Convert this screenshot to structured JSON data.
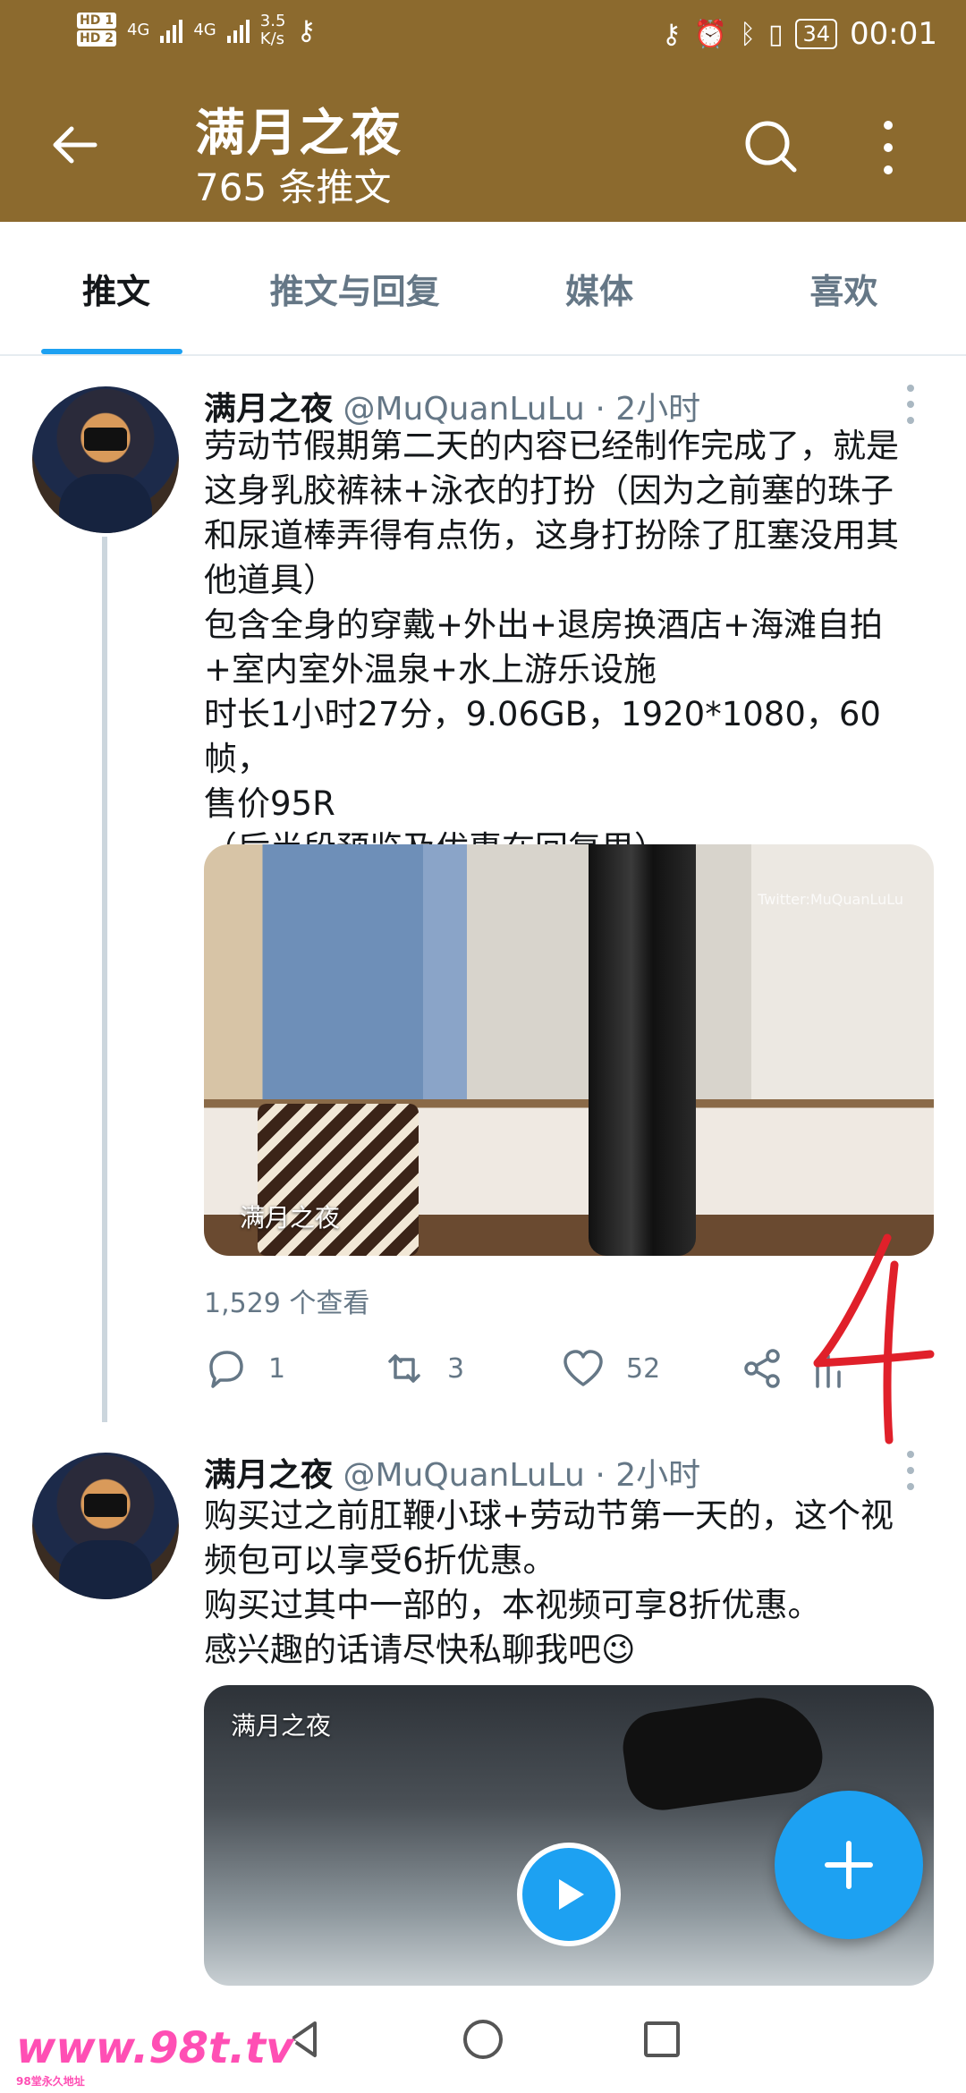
{
  "status_bar": {
    "hd1": "HD 1",
    "hd2": "HD 2",
    "net1": "4G",
    "net2": "4G",
    "speed": "3.5",
    "speed_unit": "K/s",
    "battery": "34",
    "time": "00:01"
  },
  "header": {
    "title": "满月之夜",
    "subtitle": "765 条推文",
    "back_icon": "arrow-left-icon",
    "search_icon": "search-icon",
    "more_icon": "more-vertical-icon",
    "color": "#8c6a2e"
  },
  "tabs": [
    {
      "label": "推文",
      "active": true
    },
    {
      "label": "推文与回复",
      "active": false
    },
    {
      "label": "媒体",
      "active": false
    },
    {
      "label": "喜欢",
      "active": false
    }
  ],
  "tweets": [
    {
      "name": "满月之夜",
      "handle": "@MuQuanLuLu",
      "time": "· 2小时",
      "text_lines": [
        "劳动节假期第二天的内容已经制作完成了，就是",
        "这身乳胶裤袜+泳衣的打扮（因为之前塞的珠子",
        "和尿道棒弄得有点伤，这身打扮除了肛塞没用其",
        "他道具）",
        "包含全身的穿戴+外出+退房换酒店+海滩自拍",
        "+室内室外温泉+水上游乐设施",
        "时长1小时27分，9.06GB，1920*1080，60帧，",
        "售价95R",
        "（后半段预览及优惠在回复里）"
      ],
      "media_label": "满月之夜",
      "media_watermark": "Twitter:MuQuanLuLu",
      "views": "1,529 个查看",
      "replies": "1",
      "retweets": "3",
      "likes": "52"
    },
    {
      "name": "满月之夜",
      "handle": "@MuQuanLuLu",
      "time": "· 2小时",
      "text_lines": [
        "购买过之前肛鞭小球+劳动节第一天的，这个视",
        "频包可以享受6折优惠。",
        "购买过其中一部的，本视频可享8折优惠。",
        "感兴趣的话请尽快私聊我吧😉"
      ],
      "media_label": "满月之夜"
    }
  ],
  "annotation": "4",
  "watermark": {
    "text": "www.98t.tv",
    "sub": "98堂永久地址"
  },
  "accent": "#1da1f2"
}
